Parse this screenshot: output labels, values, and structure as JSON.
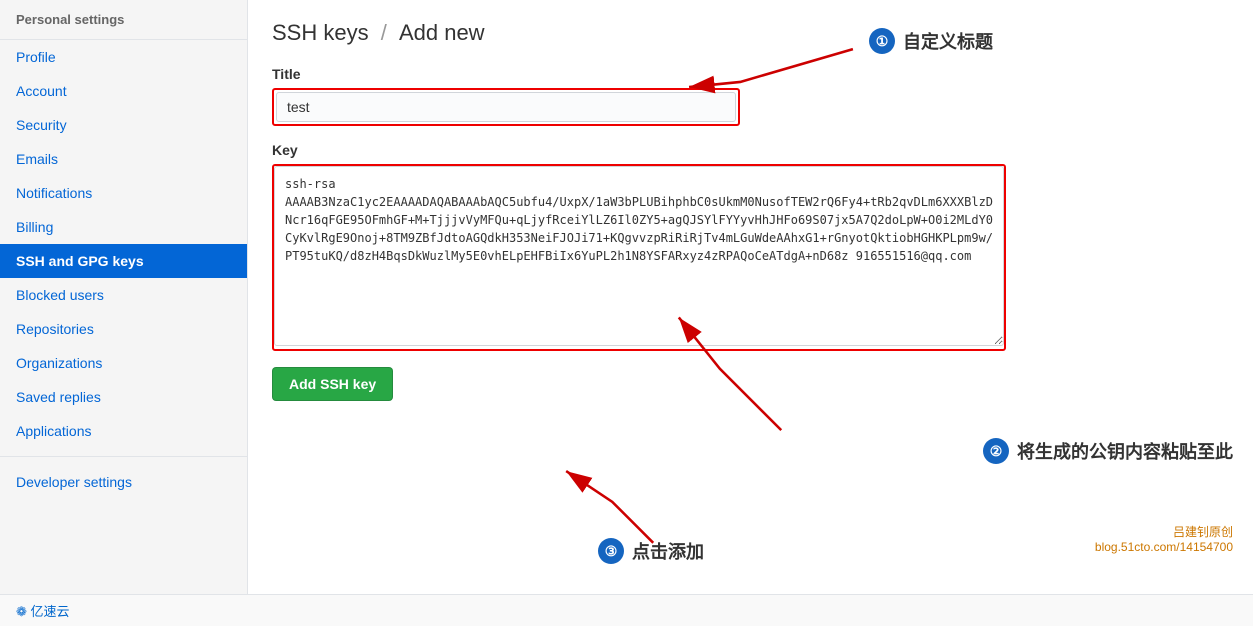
{
  "sidebar": {
    "header": "Personal settings",
    "items": [
      {
        "label": "Profile",
        "active": false,
        "id": "profile"
      },
      {
        "label": "Account",
        "active": false,
        "id": "account"
      },
      {
        "label": "Security",
        "active": false,
        "id": "security"
      },
      {
        "label": "Emails",
        "active": false,
        "id": "emails"
      },
      {
        "label": "Notifications",
        "active": false,
        "id": "notifications"
      },
      {
        "label": "Billing",
        "active": false,
        "id": "billing"
      },
      {
        "label": "SSH and GPG keys",
        "active": true,
        "id": "ssh-gpg-keys"
      },
      {
        "label": "Blocked users",
        "active": false,
        "id": "blocked-users"
      },
      {
        "label": "Repositories",
        "active": false,
        "id": "repositories"
      },
      {
        "label": "Organizations",
        "active": false,
        "id": "organizations"
      },
      {
        "label": "Saved replies",
        "active": false,
        "id": "saved-replies"
      },
      {
        "label": "Applications",
        "active": false,
        "id": "applications"
      }
    ],
    "developer_settings": "Developer settings"
  },
  "main": {
    "title_prefix": "SSH keys",
    "title_separator": "/",
    "title_suffix": "Add new",
    "title_label": "Title",
    "title_value": "test",
    "key_label": "Key",
    "key_value": "ssh-rsa AAAAB3NzaC1yc2EAAAADAQABAAAbAQC5ubfu4/UxpX/1aW3bPLUBihphbC0sUkmM0NusofTEW2rQ6Fy4+tRb2qvDLm6XXXBlzDNcr16qFGE95OFmhGF+M+TjjjvVyMFQu+qLjyfRceiYlLZ6Il0ZY5+agQJSYlFYYyvHhJHFo69S07jx5A7Q2doLpW+O0i2MLdY0CyKvlRgE9Onoj+8TM9ZBfJdtoAGQdkH353NeiFJOJi71+KQgvvzpRiRiRjTv4mLGuWdeAAhxG1+rGnyotQktiobHGHKPLpm9w/PT95tuKQ/d8zH4BqsDkWuzlMy5E0vhELpEHFBiIx6YuPL2h1N8YSFARxyz4zRPAQoCeATdgA+nD68z 916551516@qq.com",
    "add_button": "Add SSH key",
    "annotation1_label": "①",
    "annotation1_text": "自定义标题",
    "annotation2_label": "②",
    "annotation2_text": "将生成的公钥内容粘贴至此",
    "annotation3_label": "③",
    "annotation3_text": "点击添加",
    "watermark1": "吕建钊原创",
    "watermark2": "blog.51cto.com/14154700",
    "footer_logo": "❁ 亿速云"
  }
}
